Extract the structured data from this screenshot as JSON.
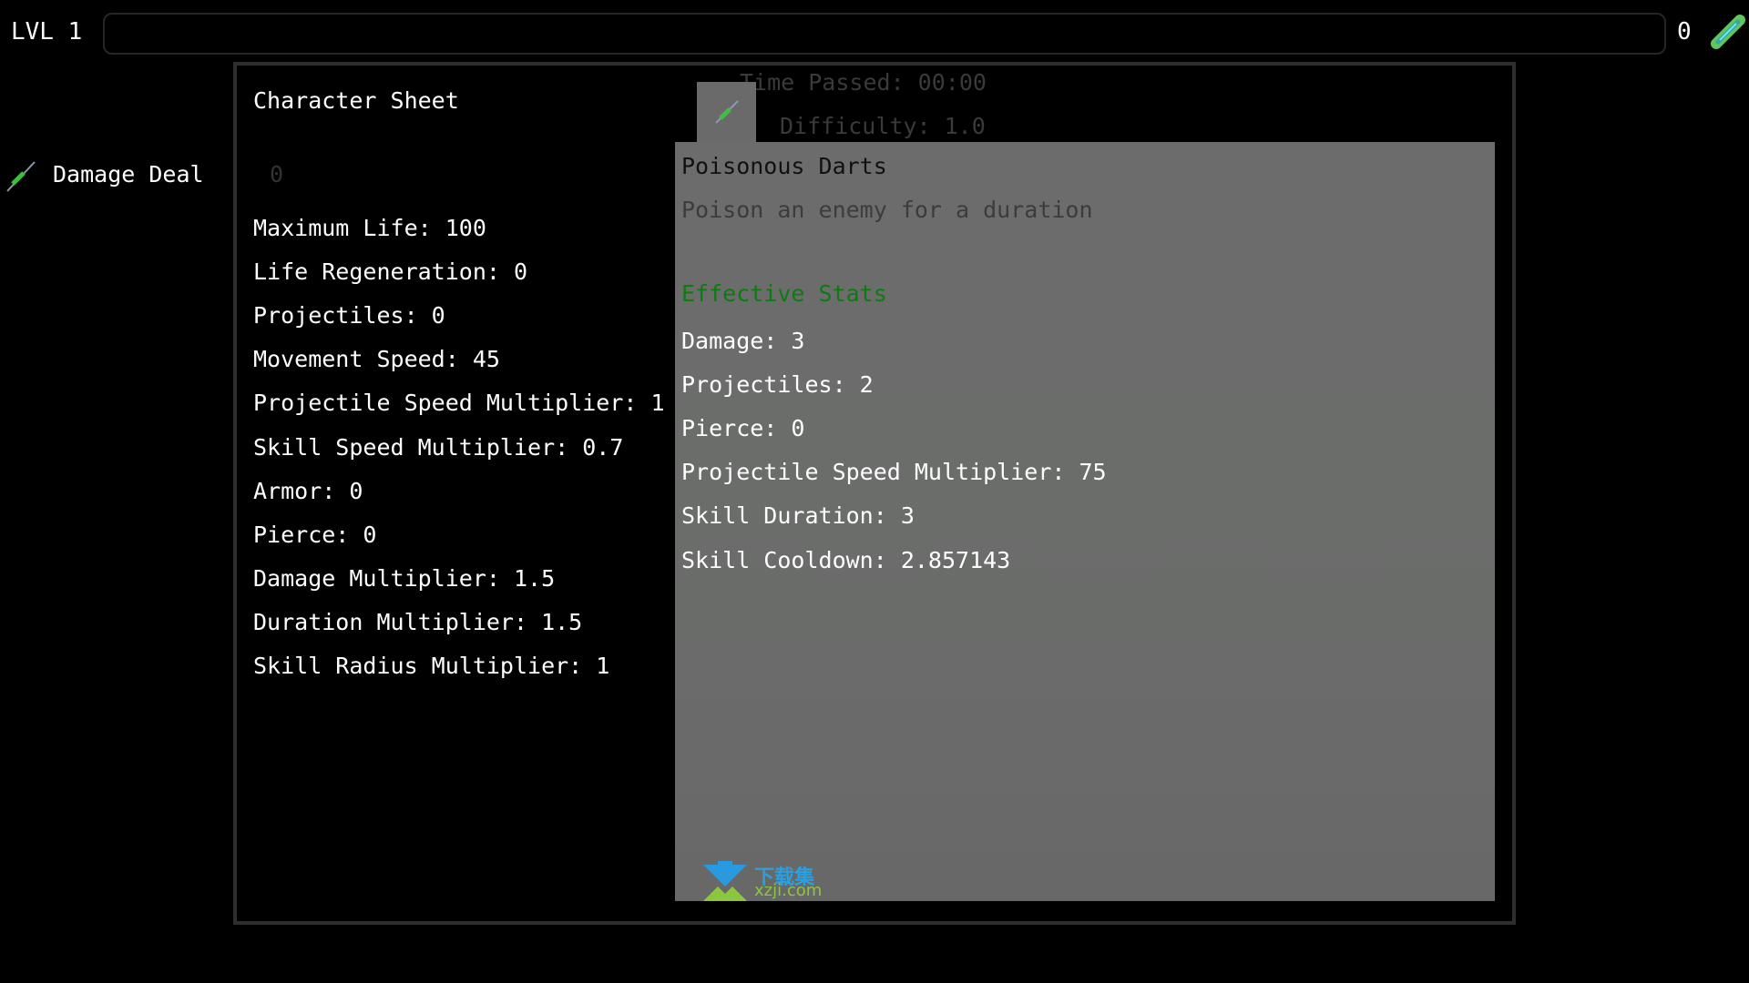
{
  "hud": {
    "level": "LVL 1",
    "xp_progress": 0,
    "gold": "0",
    "gold_icon": "gem-icon",
    "damage_dealt_label": "Damage Deal",
    "damage_dealt_value": "0",
    "time_passed": "Time Passed: 00:00",
    "difficulty": "Difficulty: 1.0"
  },
  "character_sheet": {
    "title": "Character Sheet",
    "stats": [
      "Maximum Life: 100",
      "Life Regeneration: 0",
      "Projectiles: 0",
      "Movement Speed: 45",
      "Projectile Speed Multiplier: 1",
      "Skill Speed Multiplier: 0.7",
      "Armor: 0",
      "Pierce: 0",
      "Damage Multiplier: 1.5",
      "Duration Multiplier: 1.5",
      "Skill Radius Multiplier: 1"
    ]
  },
  "skill": {
    "tab_icon": "dart-icon",
    "name": "Poisonous Darts",
    "description": "Poison an enemy for a duration",
    "effective_stats_label": "Effective Stats",
    "effective_stats": [
      "Damage: 3",
      "Projectiles: 2",
      "Pierce: 0",
      "Projectile Speed Multiplier: 75",
      "Skill Duration: 3",
      "Skill Cooldown: 2.857143"
    ]
  },
  "watermark": {
    "cn": "下载集",
    "en": "xzji.com"
  },
  "colors": {
    "effective_stats": "#0e7a12",
    "detail_bg": "#6b6b6b",
    "panel_border": "#2e2e2e"
  }
}
